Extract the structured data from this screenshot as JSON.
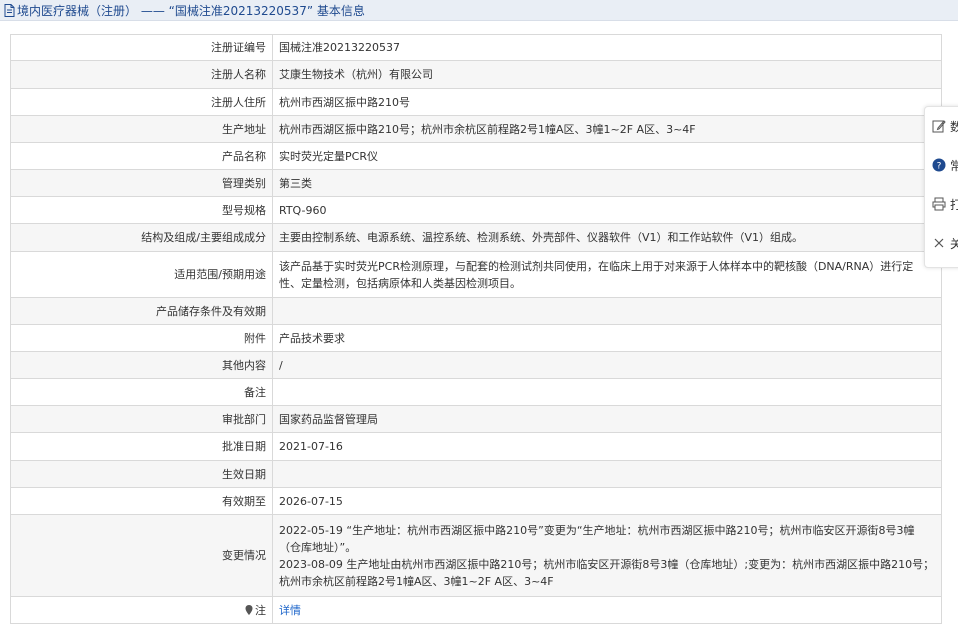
{
  "header": {
    "title": "境内医疗器械（注册） —— “国械注准20213220537” 基本信息"
  },
  "rows": [
    {
      "label": "注册证编号",
      "value": "国械注准20213220537"
    },
    {
      "label": "注册人名称",
      "value": "艾康生物技术（杭州）有限公司"
    },
    {
      "label": "注册人住所",
      "value": "杭州市西湖区振中路210号"
    },
    {
      "label": "生产地址",
      "value": "杭州市西湖区振中路210号；杭州市余杭区前程路2号1幢A区、3幢1~2F A区、3~4F"
    },
    {
      "label": "产品名称",
      "value": "实时荧光定量PCR仪"
    },
    {
      "label": "管理类别",
      "value": "第三类"
    },
    {
      "label": "型号规格",
      "value": "RTQ-960"
    },
    {
      "label": "结构及组成/主要组成成分",
      "value": "主要由控制系统、电源系统、温控系统、检测系统、外壳部件、仪器软件（V1）和工作站软件（V1）组成。"
    },
    {
      "label": "适用范围/预期用途",
      "value": "该产品基于实时荧光PCR检测原理，与配套的检测试剂共同使用，在临床上用于对来源于人体样本中的靶核酸（DNA/RNA）进行定性、定量检测，包括病原体和人类基因检测项目。"
    },
    {
      "label": "产品储存条件及有效期",
      "value": ""
    },
    {
      "label": "附件",
      "value": "产品技术要求"
    },
    {
      "label": "其他内容",
      "value": "/"
    },
    {
      "label": "备注",
      "value": ""
    },
    {
      "label": "审批部门",
      "value": "国家药品监督管理局"
    },
    {
      "label": "批准日期",
      "value": "2021-07-16"
    },
    {
      "label": "生效日期",
      "value": ""
    },
    {
      "label": "有效期至",
      "value": "2026-07-15"
    }
  ],
  "changes": {
    "label": "变更情况",
    "entries": [
      "2022-05-19 “生产地址：杭州市西湖区振中路210号”变更为“生产地址：杭州市西湖区振中路210号；杭州市临安区开源街8号3幢（仓库地址）”。",
      "2023-08-09 生产地址由杭州市西湖区振中路210号；杭州市临安区开源街8号3幢（仓库地址）;变更为：杭州市西湖区振中路210号；杭州市余杭区前程路2号1幢A区、3幢1~2F A区、3~4F"
    ]
  },
  "note": {
    "label": "注",
    "link_text": "详情"
  },
  "side_panel": {
    "items": [
      {
        "icon": "edit-icon",
        "label": "数"
      },
      {
        "icon": "help-icon",
        "label": "常"
      },
      {
        "icon": "print-icon",
        "label": "打"
      },
      {
        "icon": "close-icon",
        "label": "关"
      }
    ]
  }
}
